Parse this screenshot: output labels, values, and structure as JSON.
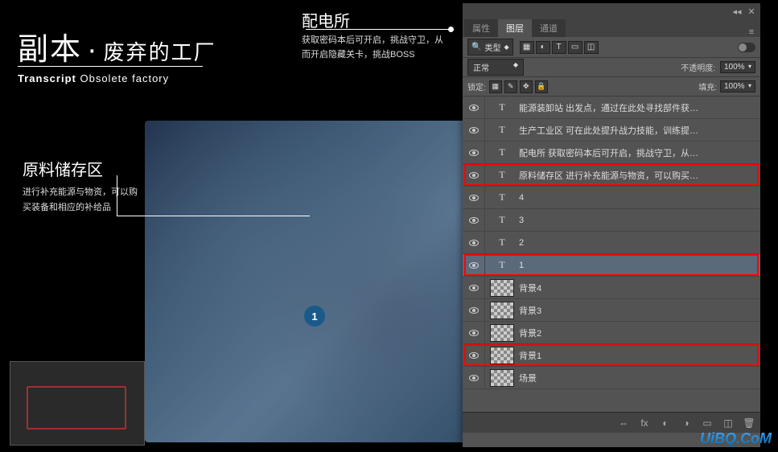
{
  "canvas": {
    "title_cn_main": "副本",
    "title_cn_dot": "·",
    "title_cn_sub": "废弃的工厂",
    "title_en_bold": "Transcript",
    "title_en_rest": "Obsolete factory",
    "label_top": "配电所",
    "desc_top": "获取密码本后可开启，挑战守卫，从而开启隐藏关卡，挑战BOSS",
    "label_left": "原料储存区",
    "desc_left": "进行补充能源与物资，可以购买装备和相应的补给品",
    "marker_1": "1"
  },
  "panel": {
    "tabs": {
      "properties": "属性",
      "layers": "图层",
      "channels": "通道"
    },
    "filter": {
      "kind_label": "类型",
      "icons": [
        "▦",
        "◐",
        "T",
        "▭",
        "◫"
      ]
    },
    "blend": {
      "mode": "正常",
      "opacity_label": "不透明度:",
      "opacity_value": "100%"
    },
    "lock": {
      "label": "锁定:",
      "fill_label": "填充:",
      "fill_value": "100%",
      "icons": [
        "▦",
        "✎",
        "✥",
        "🔒"
      ]
    },
    "layers": [
      {
        "type": "text",
        "name": "能源装卸站  出发点，通过在此处寻找部件获…"
      },
      {
        "type": "text",
        "name": "生产工业区  可在此处提升战力技能，训练提…"
      },
      {
        "type": "text",
        "name": "配电所  获取密码本后可开启，挑战守卫，从…"
      },
      {
        "type": "text",
        "name": "原料储存区  进行补充能源与物资，可以购买…",
        "hl": true
      },
      {
        "type": "text",
        "name": "4"
      },
      {
        "type": "text",
        "name": "3"
      },
      {
        "type": "text",
        "name": "2"
      },
      {
        "type": "text",
        "name": "1",
        "hl": true,
        "selected": true
      },
      {
        "type": "bg",
        "name": "背景4"
      },
      {
        "type": "bg",
        "name": "背景3"
      },
      {
        "type": "bg",
        "name": "背景2"
      },
      {
        "type": "bg",
        "name": "背景1",
        "hl": true
      },
      {
        "type": "bg",
        "name": "场景"
      }
    ],
    "footer_icons": [
      "⇔",
      "fx",
      "◐",
      "◑",
      "▭",
      "◫",
      "🗑"
    ]
  },
  "watermark": "UiBQ.CoM"
}
